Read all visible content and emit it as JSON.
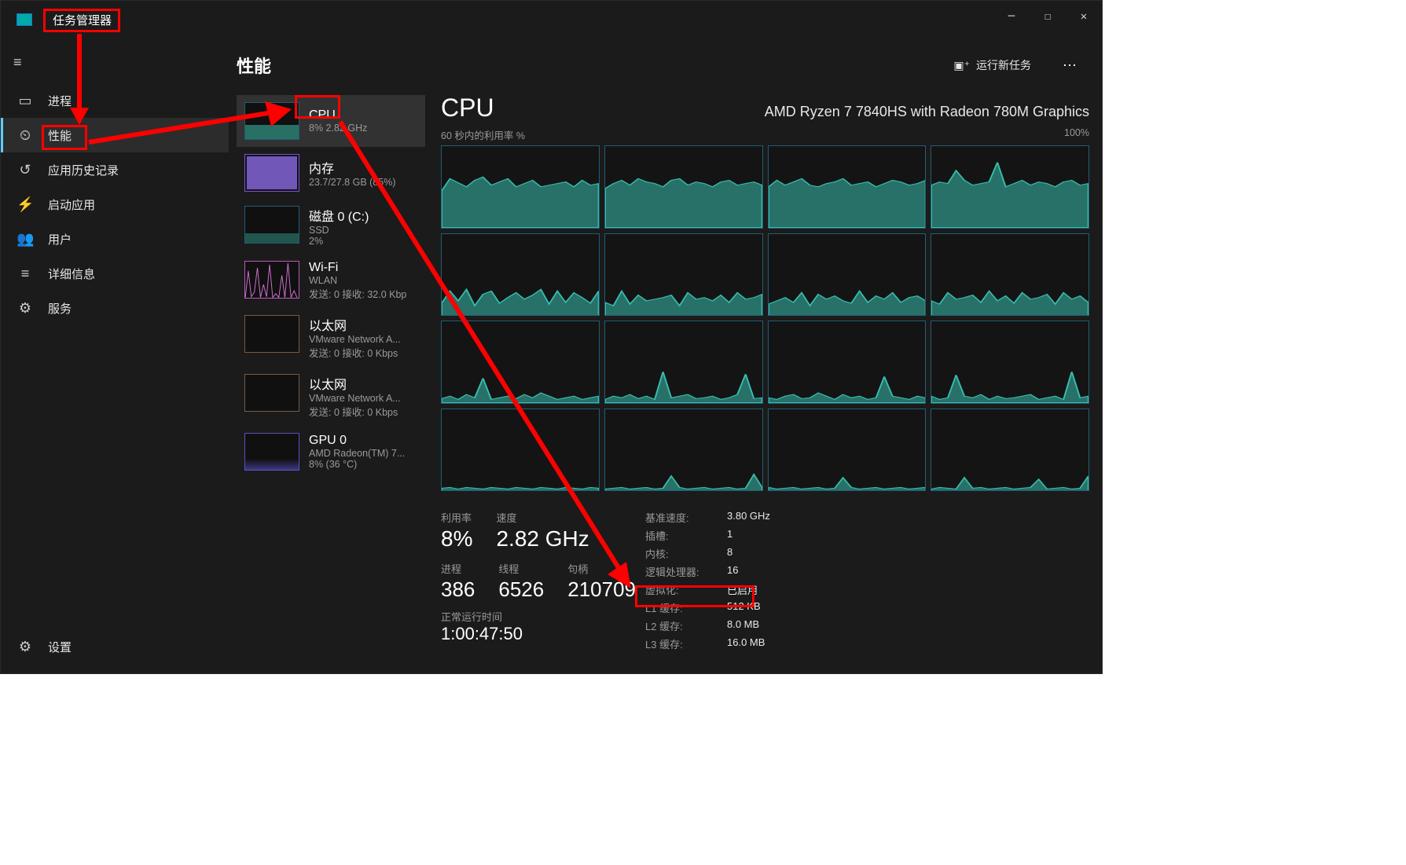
{
  "title_bar": {
    "title": "任务管理器"
  },
  "nav": {
    "items": [
      {
        "icon": "▭",
        "label": "进程"
      },
      {
        "icon": "⏲",
        "label": "性能"
      },
      {
        "icon": "↺",
        "label": "应用历史记录"
      },
      {
        "icon": "⚡",
        "label": "启动应用"
      },
      {
        "icon": "👥",
        "label": "用户"
      },
      {
        "icon": "≡",
        "label": "详细信息"
      },
      {
        "icon": "⚙",
        "label": "服务"
      }
    ],
    "settings": {
      "icon": "⚙",
      "label": "设置"
    }
  },
  "header": {
    "page_title": "性能",
    "run_task": "运行新任务"
  },
  "mini": [
    {
      "title": "CPU",
      "sub": "8%  2.82 GHz"
    },
    {
      "title": "内存",
      "sub": "23.7/27.8 GB (85%)"
    },
    {
      "title": "磁盘 0 (C:)",
      "sub1": "SSD",
      "sub2": "2%"
    },
    {
      "title": "Wi-Fi",
      "sub1": "WLAN",
      "sub2": "发送: 0 接收: 32.0 Kbp"
    },
    {
      "title": "以太网",
      "sub1": "VMware Network A...",
      "sub2": "发送: 0 接收: 0 Kbps"
    },
    {
      "title": "以太网",
      "sub1": "VMware Network A...",
      "sub2": "发送: 0 接收: 0 Kbps"
    },
    {
      "title": "GPU 0",
      "sub1": "AMD Radeon(TM) 7...",
      "sub2": "8% (36 °C)"
    }
  ],
  "cpu": {
    "heading": "CPU",
    "name": "AMD Ryzen 7 7840HS with Radeon 780M Graphics",
    "axis_left": "60 秒内的利用率 %",
    "axis_right": "100%",
    "stats": {
      "util_label": "利用率",
      "util_value": "8%",
      "speed_label": "速度",
      "speed_value": "2.82 GHz",
      "proc_label": "进程",
      "proc_value": "386",
      "thread_label": "线程",
      "thread_value": "6526",
      "handle_label": "句柄",
      "handle_value": "210709",
      "uptime_label": "正常运行时间",
      "uptime_value": "1:00:47:50"
    },
    "side": [
      {
        "k": "基准速度:",
        "v": "3.80 GHz"
      },
      {
        "k": "插槽:",
        "v": "1"
      },
      {
        "k": "内核:",
        "v": "8"
      },
      {
        "k": "逻辑处理器:",
        "v": "16"
      },
      {
        "k": "虚拟化:",
        "v": "已启用"
      },
      {
        "k": "L1 缓存:",
        "v": "512 KB"
      },
      {
        "k": "L2 缓存:",
        "v": "8.0 MB"
      },
      {
        "k": "L3 缓存:",
        "v": "16.0 MB"
      }
    ]
  }
}
